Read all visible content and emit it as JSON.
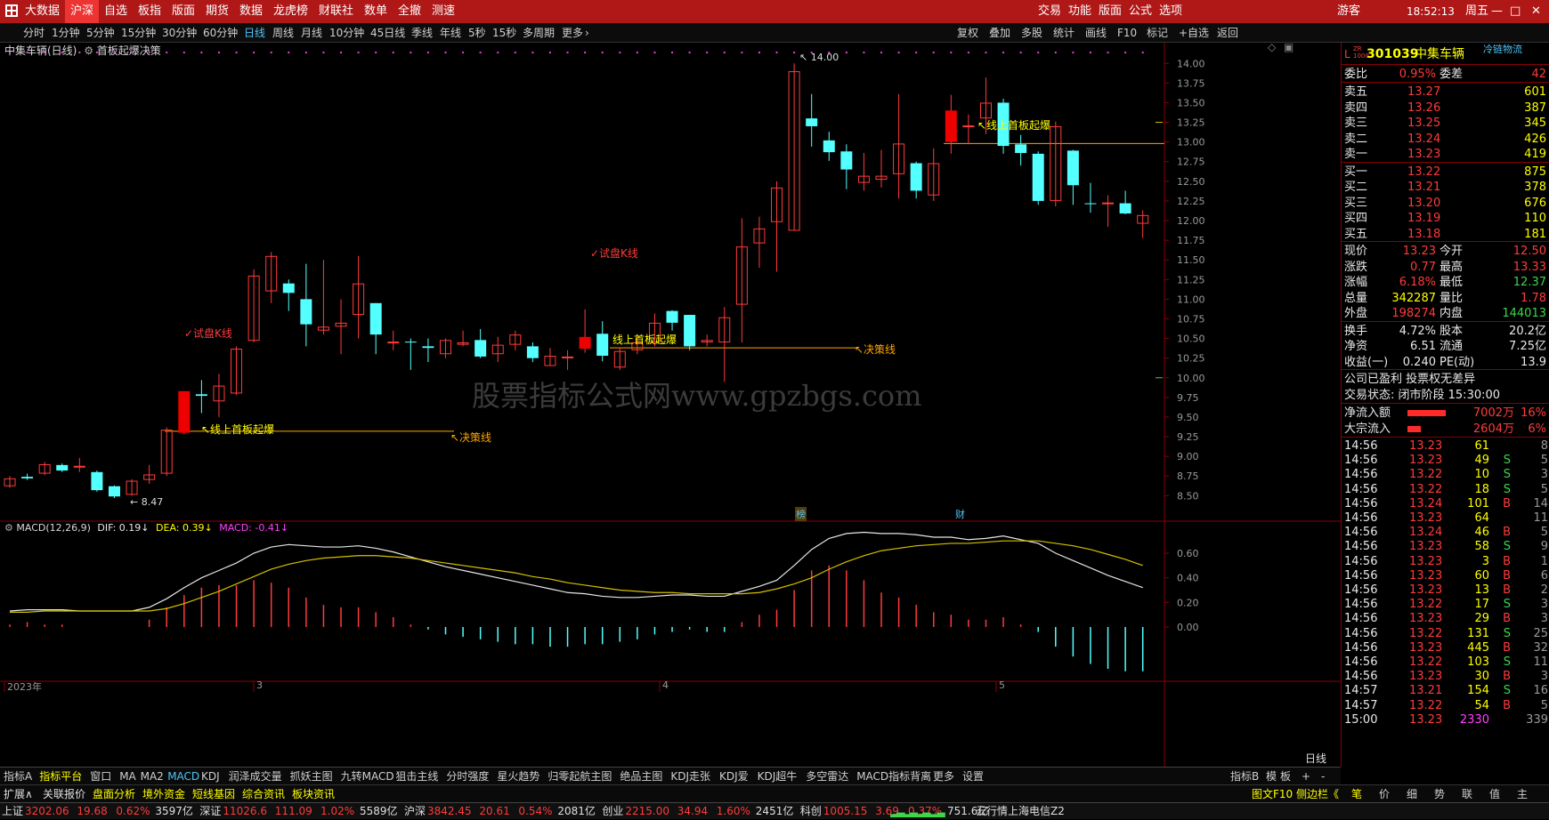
{
  "menubar": {
    "left_items": [
      "大数据",
      "沪深",
      "自选",
      "板指",
      "版面",
      "期货",
      "数据",
      "龙虎榜",
      "财联社",
      "数单",
      "全撤",
      "测速"
    ],
    "right_items": [
      "交易",
      "功能",
      "版面",
      "公式",
      "选项"
    ],
    "user": "游客",
    "time": "18:52:13",
    "weekday": "周五",
    "window_buttons": [
      "—",
      "□",
      "✕"
    ]
  },
  "periodbar": {
    "items": [
      "分时",
      "1分钟",
      "5分钟",
      "15分钟",
      "30分钟",
      "60分钟",
      "日线",
      "周线",
      "月线",
      "10分钟",
      "45日线",
      "季线",
      "年线",
      "5秒",
      "15秒",
      "多周期",
      "更多"
    ],
    "active": "日线",
    "right_items": [
      "复权",
      "叠加",
      "多股",
      "统计",
      "画线",
      "F10",
      "标记",
      "+自选",
      "返回"
    ]
  },
  "chart_header": {
    "stock_period": "中集车辆(日线)",
    "indicator": "首板起爆决策"
  },
  "main_chart": {
    "price_axis": [
      "14.00",
      "13.75",
      "13.50",
      "13.25",
      "13.00",
      "12.75",
      "12.50",
      "12.25",
      "12.00",
      "11.75",
      "11.50",
      "11.25",
      "11.00",
      "10.75",
      "10.50",
      "10.25",
      "10.00",
      "9.75",
      "9.50",
      "9.25",
      "9.00",
      "8.75",
      "8.50"
    ],
    "high_label": "14.00",
    "low_label": "8.47",
    "watermark": "股票指标公式网www.gpzbgs.com",
    "annotations": {
      "trial1": "✓试盘K线",
      "trial2": "✓试盘K线",
      "breakout1": "↖线上首板起爆",
      "breakout2": "线上首板起爆",
      "breakout3": "↖线上首板起爆",
      "decision1": "↖决策线",
      "decision2": "↖决策线"
    },
    "event_markers": [
      "榜",
      "财"
    ]
  },
  "chart_data": {
    "type": "candlestick",
    "ylim": [
      8.3,
      14.15
    ],
    "candles": [
      {
        "o": 8.62,
        "c": 8.72,
        "h": 8.75,
        "l": 8.6
      },
      {
        "o": 8.74,
        "c": 8.72,
        "h": 8.78,
        "l": 8.7
      },
      {
        "o": 8.78,
        "c": 8.9,
        "h": 8.93,
        "l": 8.76
      },
      {
        "o": 8.89,
        "c": 8.82,
        "h": 8.91,
        "l": 8.8
      },
      {
        "o": 8.86,
        "c": 8.88,
        "h": 8.98,
        "l": 8.8
      },
      {
        "o": 8.8,
        "c": 8.57,
        "h": 8.82,
        "l": 8.55
      },
      {
        "o": 8.62,
        "c": 8.49,
        "h": 8.63,
        "l": 8.47
      },
      {
        "o": 8.51,
        "c": 8.69,
        "h": 8.71,
        "l": 8.5
      },
      {
        "o": 8.7,
        "c": 8.77,
        "h": 8.89,
        "l": 8.65
      },
      {
        "o": 8.78,
        "c": 9.34,
        "h": 9.37,
        "l": 8.75
      },
      {
        "o": 9.3,
        "c": 9.83,
        "h": 9.83,
        "l": 9.28
      },
      {
        "o": 9.79,
        "c": 9.77,
        "h": 9.97,
        "l": 9.55
      },
      {
        "o": 9.7,
        "c": 9.9,
        "h": 10.05,
        "l": 9.5
      },
      {
        "o": 9.8,
        "c": 10.37,
        "h": 10.4,
        "l": 9.78
      },
      {
        "o": 10.47,
        "c": 11.3,
        "h": 11.38,
        "l": 10.45
      },
      {
        "o": 11.1,
        "c": 11.55,
        "h": 11.6,
        "l": 10.95
      },
      {
        "o": 11.2,
        "c": 11.08,
        "h": 11.25,
        "l": 10.85
      },
      {
        "o": 11.0,
        "c": 10.68,
        "h": 11.45,
        "l": 10.4
      },
      {
        "o": 10.6,
        "c": 10.65,
        "h": 11.5,
        "l": 10.55
      },
      {
        "o": 10.65,
        "c": 10.7,
        "h": 11.0,
        "l": 10.3
      },
      {
        "o": 10.8,
        "c": 11.2,
        "h": 11.55,
        "l": 10.5
      },
      {
        "o": 10.95,
        "c": 10.55,
        "h": 10.95,
        "l": 10.3
      },
      {
        "o": 10.45,
        "c": 10.46,
        "h": 10.6,
        "l": 10.35
      },
      {
        "o": 10.46,
        "c": 10.45,
        "h": 10.5,
        "l": 10.1
      },
      {
        "o": 10.4,
        "c": 10.38,
        "h": 10.5,
        "l": 10.2
      },
      {
        "o": 10.3,
        "c": 10.48,
        "h": 10.5,
        "l": 10.25
      },
      {
        "o": 10.42,
        "c": 10.45,
        "h": 10.6,
        "l": 10.4
      },
      {
        "o": 10.48,
        "c": 10.27,
        "h": 10.62,
        "l": 10.25
      },
      {
        "o": 10.3,
        "c": 10.42,
        "h": 10.52,
        "l": 10.2
      },
      {
        "o": 10.42,
        "c": 10.55,
        "h": 10.6,
        "l": 10.35
      },
      {
        "o": 10.4,
        "c": 10.25,
        "h": 10.45,
        "l": 10.2
      },
      {
        "o": 10.15,
        "c": 10.28,
        "h": 10.38,
        "l": 10.15
      },
      {
        "o": 10.26,
        "c": 10.27,
        "h": 10.35,
        "l": 10.1
      },
      {
        "o": 10.37,
        "c": 10.52,
        "h": 10.87,
        "l": 10.32
      },
      {
        "o": 10.56,
        "c": 10.28,
        "h": 10.72,
        "l": 10.21
      },
      {
        "o": 10.13,
        "c": 10.34,
        "h": 10.38,
        "l": 10.1
      },
      {
        "o": 10.35,
        "c": 10.45,
        "h": 10.55,
        "l": 10.3
      },
      {
        "o": 10.45,
        "c": 10.7,
        "h": 10.82,
        "l": 10.4
      },
      {
        "o": 10.85,
        "c": 10.7,
        "h": 10.86,
        "l": 10.6
      },
      {
        "o": 10.8,
        "c": 10.4,
        "h": 10.8,
        "l": 10.35
      },
      {
        "o": 10.45,
        "c": 10.48,
        "h": 10.55,
        "l": 10.4
      },
      {
        "o": 10.45,
        "c": 10.77,
        "h": 10.9,
        "l": 9.95
      },
      {
        "o": 10.93,
        "c": 11.67,
        "h": 12.03,
        "l": 10.45
      },
      {
        "o": 11.71,
        "c": 11.9,
        "h": 12.05,
        "l": 11.4
      },
      {
        "o": 11.98,
        "c": 12.42,
        "h": 12.5,
        "l": 11.35
      },
      {
        "o": 11.87,
        "c": 13.9,
        "h": 14.0,
        "l": 11.87
      },
      {
        "o": 13.3,
        "c": 13.2,
        "h": 13.61,
        "l": 12.94
      },
      {
        "o": 13.02,
        "c": 12.87,
        "h": 13.13,
        "l": 12.76
      },
      {
        "o": 12.88,
        "c": 12.65,
        "h": 12.97,
        "l": 12.4
      },
      {
        "o": 12.48,
        "c": 12.57,
        "h": 12.86,
        "l": 12.38
      },
      {
        "o": 12.52,
        "c": 12.57,
        "h": 12.9,
        "l": 12.42
      },
      {
        "o": 12.59,
        "c": 12.98,
        "h": 13.61,
        "l": 12.28
      },
      {
        "o": 12.73,
        "c": 12.38,
        "h": 12.75,
        "l": 12.28
      },
      {
        "o": 12.32,
        "c": 12.73,
        "h": 12.92,
        "l": 12.25
      },
      {
        "o": 13.0,
        "c": 13.4,
        "h": 13.6,
        "l": 12.85
      },
      {
        "o": 13.2,
        "c": 13.21,
        "h": 13.35,
        "l": 12.97
      },
      {
        "o": 13.3,
        "c": 13.5,
        "h": 13.82,
        "l": 13.1
      },
      {
        "o": 13.5,
        "c": 12.95,
        "h": 13.55,
        "l": 12.85
      },
      {
        "o": 12.97,
        "c": 12.86,
        "h": 13.09,
        "l": 12.7
      },
      {
        "o": 12.85,
        "c": 12.25,
        "h": 12.88,
        "l": 12.2
      },
      {
        "o": 12.25,
        "c": 13.2,
        "h": 13.26,
        "l": 12.18
      },
      {
        "o": 12.89,
        "c": 12.45,
        "h": 12.9,
        "l": 12.2
      },
      {
        "o": 12.22,
        "c": 12.21,
        "h": 12.48,
        "l": 12.1
      },
      {
        "o": 12.22,
        "c": 12.23,
        "h": 12.32,
        "l": 11.92
      },
      {
        "o": 12.22,
        "c": 12.09,
        "h": 12.38,
        "l": 12.08
      },
      {
        "o": 11.96,
        "c": 12.07,
        "h": 12.13,
        "l": 11.78
      }
    ]
  },
  "macd_panel": {
    "label": "MACD(12,26,9)",
    "dif_label": "DIF: 0.19↓",
    "dea_label": "DEA: 0.39↓",
    "macd_label": "MACD: -0.41↓",
    "axis": [
      "0.60",
      "0.40",
      "0.20",
      "0.00"
    ],
    "dif": [
      0.13,
      0.14,
      0.14,
      0.14,
      0.13,
      0.13,
      0.13,
      0.13,
      0.16,
      0.23,
      0.32,
      0.4,
      0.46,
      0.52,
      0.6,
      0.65,
      0.67,
      0.66,
      0.65,
      0.65,
      0.66,
      0.64,
      0.61,
      0.57,
      0.53,
      0.49,
      0.46,
      0.43,
      0.4,
      0.37,
      0.34,
      0.31,
      0.28,
      0.27,
      0.25,
      0.24,
      0.24,
      0.25,
      0.26,
      0.26,
      0.25,
      0.25,
      0.29,
      0.33,
      0.38,
      0.5,
      0.63,
      0.72,
      0.76,
      0.77,
      0.76,
      0.76,
      0.75,
      0.73,
      0.73,
      0.71,
      0.72,
      0.74,
      0.71,
      0.68,
      0.6,
      0.54,
      0.48,
      0.42,
      0.37,
      0.32,
      0.26
    ],
    "dea": [
      0.12,
      0.12,
      0.13,
      0.13,
      0.13,
      0.13,
      0.13,
      0.13,
      0.13,
      0.15,
      0.19,
      0.24,
      0.29,
      0.35,
      0.41,
      0.47,
      0.51,
      0.54,
      0.56,
      0.57,
      0.58,
      0.58,
      0.57,
      0.56,
      0.54,
      0.52,
      0.5,
      0.48,
      0.46,
      0.44,
      0.41,
      0.39,
      0.36,
      0.34,
      0.32,
      0.3,
      0.29,
      0.28,
      0.28,
      0.27,
      0.27,
      0.27,
      0.27,
      0.28,
      0.31,
      0.35,
      0.4,
      0.47,
      0.53,
      0.58,
      0.62,
      0.64,
      0.66,
      0.67,
      0.68,
      0.68,
      0.69,
      0.7,
      0.7,
      0.7,
      0.68,
      0.66,
      0.63,
      0.59,
      0.55,
      0.5,
      0.45
    ],
    "time_axis": [
      "2023年",
      "3",
      "4",
      "5"
    ]
  },
  "side_panel": {
    "header": {
      "prefix": "L",
      "code": "301039",
      "name": "中集车辆",
      "badge": "ZR 1000",
      "tag": "冷链物流"
    },
    "weibi": {
      "label": "委比",
      "value": "0.95%",
      "label2": "委差",
      "value2": "42"
    },
    "asks": [
      {
        "label": "卖五",
        "price": "13.27",
        "vol": "601"
      },
      {
        "label": "卖四",
        "price": "13.26",
        "vol": "387"
      },
      {
        "label": "卖三",
        "price": "13.25",
        "vol": "345"
      },
      {
        "label": "卖二",
        "price": "13.24",
        "vol": "426"
      },
      {
        "label": "卖一",
        "price": "13.23",
        "vol": "419"
      }
    ],
    "bids": [
      {
        "label": "买一",
        "price": "13.22",
        "vol": "875"
      },
      {
        "label": "买二",
        "price": "13.21",
        "vol": "378"
      },
      {
        "label": "买三",
        "price": "13.20",
        "vol": "676"
      },
      {
        "label": "买四",
        "price": "13.19",
        "vol": "110"
      },
      {
        "label": "买五",
        "price": "13.18",
        "vol": "181"
      }
    ],
    "quote": [
      {
        "l1": "现价",
        "v1": "13.23",
        "l2": "今开",
        "v2": "12.50"
      },
      {
        "l1": "涨跌",
        "v1": "0.77",
        "l2": "最高",
        "v2": "13.33"
      },
      {
        "l1": "涨幅",
        "v1": "6.18%",
        "l2": "最低",
        "v2": "12.37"
      },
      {
        "l1": "总量",
        "v1": "342287",
        "l2": "量比",
        "v2": "1.78"
      },
      {
        "l1": "外盘",
        "v1": "198274",
        "l2": "内盘",
        "v2": "144013"
      }
    ],
    "fundamentals": [
      {
        "l1": "换手",
        "v1": "4.72%",
        "l2": "股本",
        "v2": "20.2亿"
      },
      {
        "l1": "净资",
        "v1": "6.51",
        "l2": "流通",
        "v2": "7.25亿"
      },
      {
        "l1": "收益(一)",
        "v1": "0.240",
        "l2": "PE(动)",
        "v2": "13.9"
      }
    ],
    "notes": [
      "公司已盈利 投票权无差异",
      "交易状态: 闭市阶段 15:30:00"
    ],
    "flows": [
      {
        "label": "净流入额",
        "value": "7002万",
        "pct": "16%",
        "bar": 0.72
      },
      {
        "label": "大宗流入",
        "value": "2604万",
        "pct": "6%",
        "bar": 0.25
      }
    ],
    "ticks": [
      {
        "t": "14:56",
        "p": "13.23",
        "v": "61",
        "s": "",
        "n": "8"
      },
      {
        "t": "14:56",
        "p": "13.23",
        "v": "49",
        "s": "S",
        "n": "5"
      },
      {
        "t": "14:56",
        "p": "13.22",
        "v": "10",
        "s": "S",
        "n": "3"
      },
      {
        "t": "14:56",
        "p": "13.22",
        "v": "18",
        "s": "S",
        "n": "5"
      },
      {
        "t": "14:56",
        "p": "13.24",
        "v": "101",
        "s": "B",
        "n": "14"
      },
      {
        "t": "14:56",
        "p": "13.23",
        "v": "64",
        "s": "",
        "n": "11"
      },
      {
        "t": "14:56",
        "p": "13.24",
        "v": "46",
        "s": "B",
        "n": "5"
      },
      {
        "t": "14:56",
        "p": "13.23",
        "v": "58",
        "s": "S",
        "n": "9"
      },
      {
        "t": "14:56",
        "p": "13.23",
        "v": "3",
        "s": "B",
        "n": "1"
      },
      {
        "t": "14:56",
        "p": "13.23",
        "v": "60",
        "s": "B",
        "n": "6"
      },
      {
        "t": "14:56",
        "p": "13.23",
        "v": "13",
        "s": "B",
        "n": "2"
      },
      {
        "t": "14:56",
        "p": "13.22",
        "v": "17",
        "s": "S",
        "n": "3"
      },
      {
        "t": "14:56",
        "p": "13.23",
        "v": "29",
        "s": "B",
        "n": "3"
      },
      {
        "t": "14:56",
        "p": "13.22",
        "v": "131",
        "s": "S",
        "n": "25"
      },
      {
        "t": "14:56",
        "p": "13.23",
        "v": "445",
        "s": "B",
        "n": "32"
      },
      {
        "t": "14:56",
        "p": "13.22",
        "v": "103",
        "s": "S",
        "n": "11"
      },
      {
        "t": "14:56",
        "p": "13.23",
        "v": "30",
        "s": "B",
        "n": "3"
      },
      {
        "t": "14:57",
        "p": "13.21",
        "v": "154",
        "s": "S",
        "n": "16"
      },
      {
        "t": "14:57",
        "p": "13.22",
        "v": "54",
        "s": "B",
        "n": "5"
      },
      {
        "t": "15:00",
        "p": "13.23",
        "v": "2330",
        "s": "",
        "n": "339"
      }
    ]
  },
  "tabbar": {
    "items": [
      "指标A",
      "指标平台",
      "窗口",
      "MA",
      "MA2",
      "MACD",
      "KDJ",
      "润泽成交量",
      "抓妖主图",
      "九转MACD",
      "狙击主线",
      "分时强度",
      "星火趋势",
      "归零起航主图",
      "绝品主图",
      "KDJ走张",
      "KDJ爱",
      "KDJ超牛",
      "多空雷达",
      "MACD指标背离",
      "更多",
      "设置"
    ],
    "active": "MACD",
    "right_items": [
      "指标B",
      "模",
      "板"
    ],
    "period_label": "日线"
  },
  "tabbar2": {
    "items": [
      "扩展∧",
      "关联报价",
      "盘面分析",
      "境外资金",
      "短线基因",
      "综合资讯",
      "板块资讯"
    ],
    "right": [
      "图文F10",
      "侧边栏《"
    ],
    "side_tabs": [
      "笔",
      "价",
      "细",
      "势",
      "联",
      "值",
      "主"
    ]
  },
  "statusbar": {
    "indices": [
      {
        "name": "上证",
        "value": "3202.06",
        "chg": "19.68",
        "pct": "0.62%",
        "amt": "3597亿"
      },
      {
        "name": "深证",
        "value": "11026.6",
        "chg": "111.09",
        "pct": "1.02%",
        "amt": "5589亿"
      },
      {
        "name": "沪深",
        "value": "3842.45",
        "chg": "20.61",
        "pct": "0.54%",
        "amt": "2081亿"
      },
      {
        "name": "创业",
        "value": "2215.00",
        "chg": "34.94",
        "pct": "1.60%",
        "amt": "2451亿"
      },
      {
        "name": "科创",
        "value": "1005.15",
        "chg": "3.69",
        "pct": "0.37%",
        "amt": "751.6亿"
      }
    ],
    "server": "云行情上海电信Z2"
  },
  "colors": {
    "up": "#ff3b3b",
    "down": "#54ffff",
    "brand": "#b01818",
    "dif": "#e6e6e6",
    "dea": "#d4c000",
    "decision": "#ffa500",
    "annotation_yellow": "#ffff00"
  }
}
